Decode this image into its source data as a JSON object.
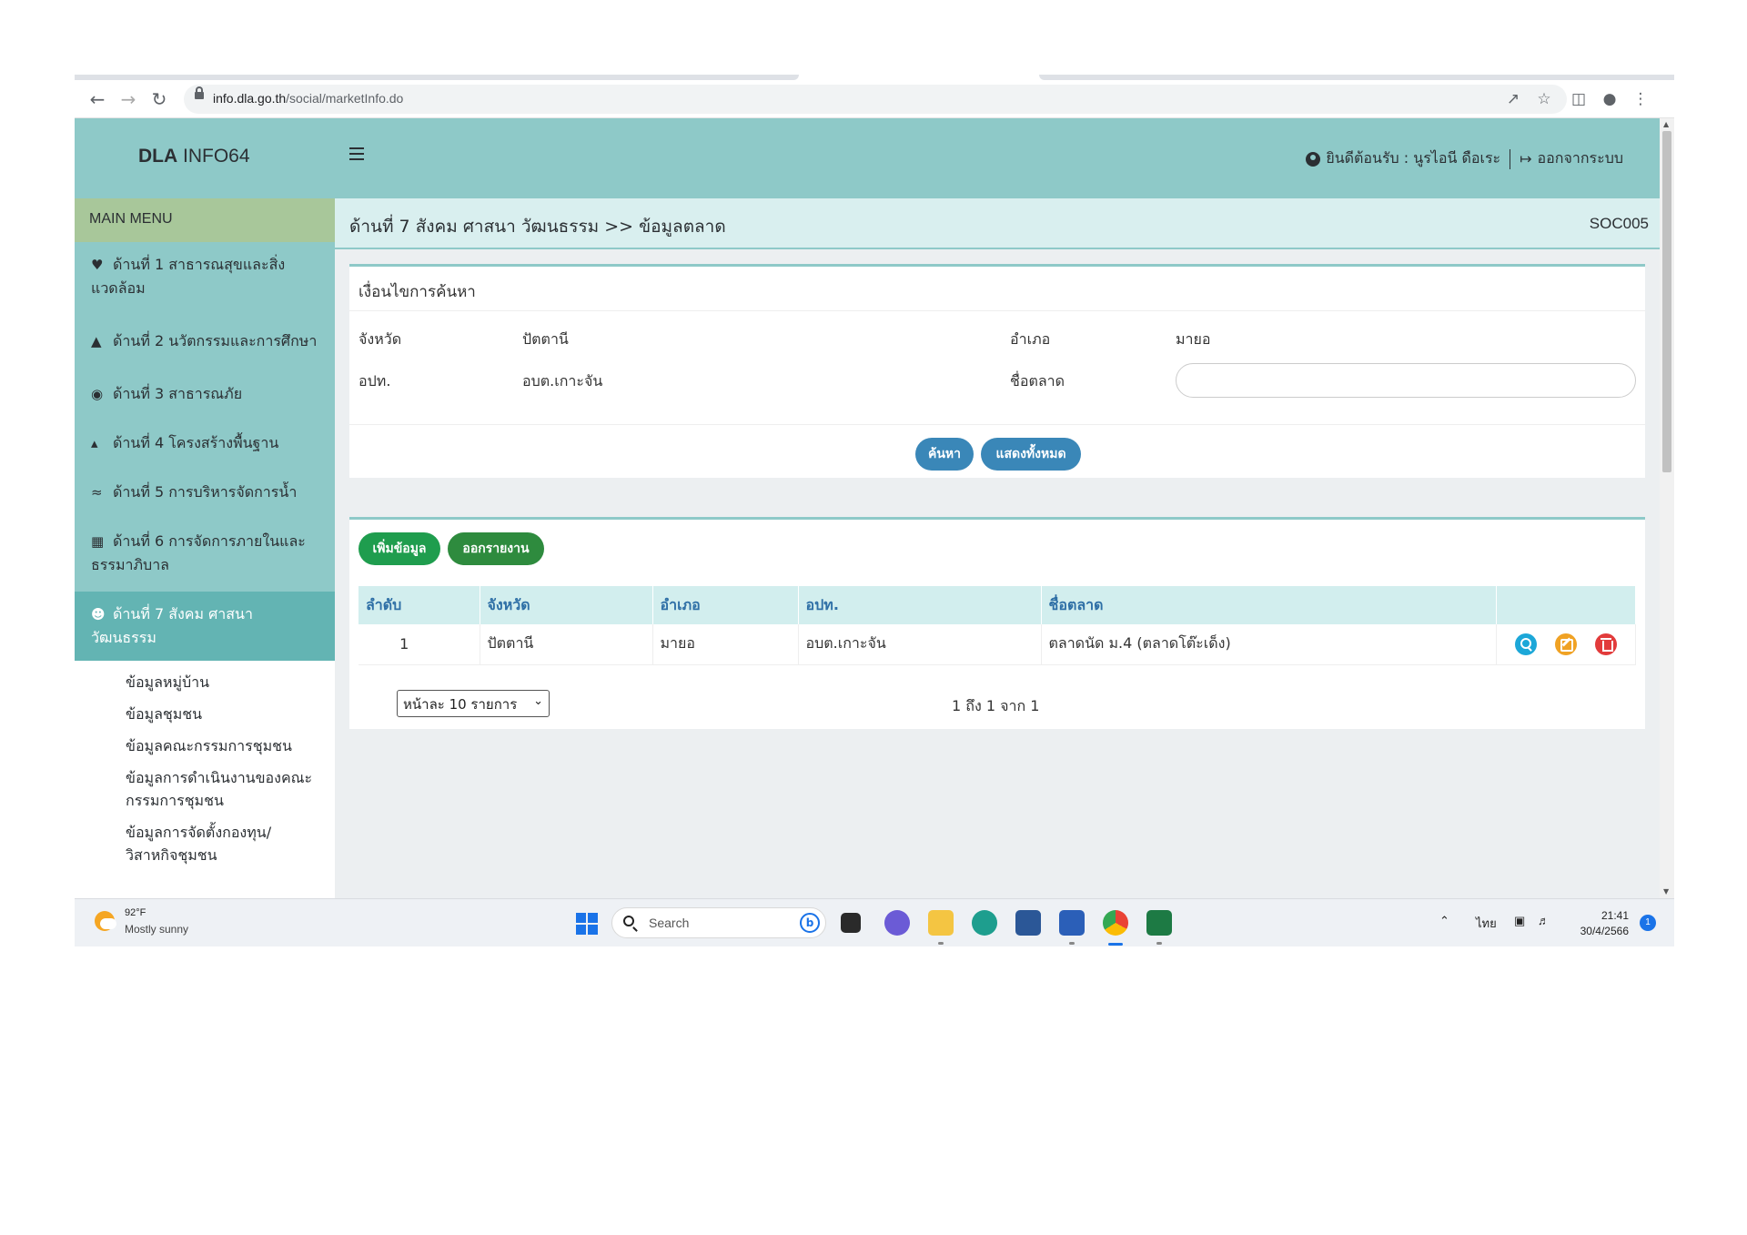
{
  "browser": {
    "url_host": "info.dla.go.th",
    "url_path": "/social/marketInfo.do",
    "icons": [
      "back-arrow-icon",
      "forward-arrow-icon",
      "reload-icon",
      "lock-icon",
      "share-icon",
      "star-icon",
      "sidepanel-icon",
      "profile-icon",
      "kebab-menu-icon"
    ]
  },
  "header": {
    "brand_bold": "DLA",
    "brand_rest": " INFO64",
    "welcome": "ยินดีต้อนรับ : นูรไอนี ดือเระ",
    "logout": "ออกจากระบบ"
  },
  "sidebar": {
    "heading": "MAIN MENU",
    "items": [
      {
        "icon": "heartbeat-icon",
        "label": "ด้านที่ 1 สาธารณสุขและสิ่งแวดล้อม"
      },
      {
        "icon": "school-icon",
        "label": "ด้านที่ 2 นวัตกรรมและการศึกษา"
      },
      {
        "icon": "user-shield-icon",
        "label": "ด้านที่ 3 สาธารณภัย"
      },
      {
        "icon": "road-icon",
        "label": "ด้านที่ 4 โครงสร้างพื้นฐาน"
      },
      {
        "icon": "water-icon",
        "label": "ด้านที่ 5 การบริหารจัดการน้ำ"
      },
      {
        "icon": "building-icon",
        "label": "ด้านที่ 6 การจัดการภายในและธรรมาภิบาล"
      },
      {
        "icon": "users-icon",
        "label": "ด้านที่ 7 สังคม ศาสนา วัฒนธรรม",
        "active": true
      }
    ],
    "subitems": [
      "ข้อมูลหมู่บ้าน",
      "ข้อมูลชุมชน",
      "ข้อมูลคณะกรรมการชุมชน",
      "ข้อมูลการดำเนินงานของคณะกรรมการชุมชน",
      "ข้อมูลการจัดตั้งกองทุน/วิสาหกิจชุมชน"
    ]
  },
  "page": {
    "breadcrumb": "ด้านที่ 7 สังคม ศาสนา วัฒนธรรม >>  ข้อมูลตลาด",
    "code": "SOC005"
  },
  "search": {
    "title": "เงื่อนไขการค้นหา",
    "province_label": "จังหวัด",
    "province_value": "ปัตตานี",
    "district_label": "อำเภอ",
    "district_value": "มายอ",
    "lao_label": "อปท.",
    "lao_value": "อบต.เกาะจัน",
    "market_label": "ชื่อตลาด",
    "market_value": "",
    "search_button": "ค้นหา",
    "showall_button": "แสดงทั้งหมด"
  },
  "results": {
    "add_button": "เพิ่มข้อมูล",
    "report_button": "ออกรายงาน",
    "columns": [
      "ลำดับ",
      "จังหวัด",
      "อำเภอ",
      "อปท.",
      "ชื่อตลาด",
      ""
    ],
    "rows": [
      {
        "no": "1",
        "province": "ปัตตานี",
        "district": "มายอ",
        "lao": "อบต.เกาะจัน",
        "market": "ตลาดนัด ม.4 (ตลาดโต๊ะเด็ง)"
      }
    ],
    "page_size": "หน้าละ 10 รายการ",
    "page_info": "1 ถึง 1 จาก 1"
  },
  "taskbar": {
    "temp": "92°F",
    "weather": "Mostly sunny",
    "search": "Search",
    "lang": "ไทย",
    "time": "21:41",
    "date": "30/4/2566",
    "notifications": "1"
  }
}
